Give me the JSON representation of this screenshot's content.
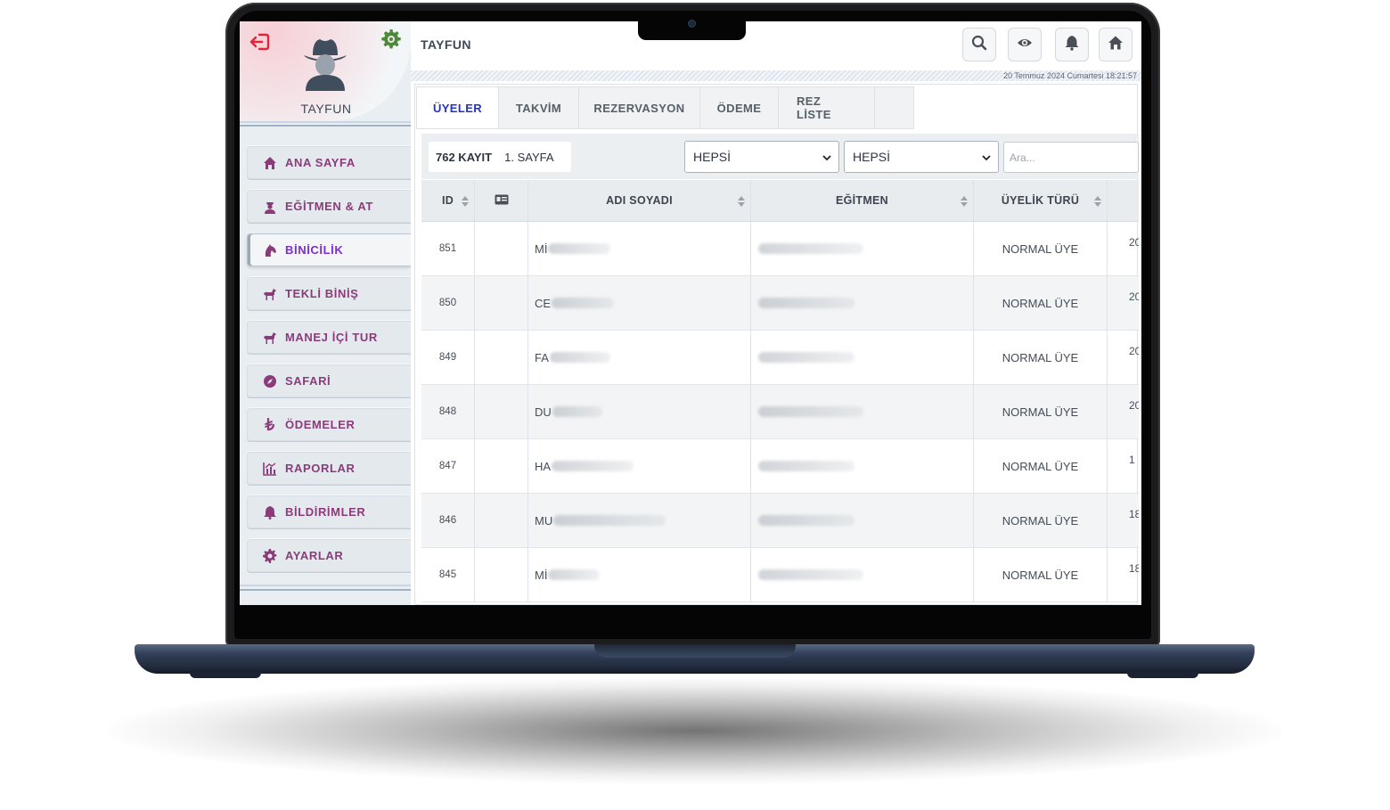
{
  "user": {
    "name": "TAYFUN"
  },
  "topbar": {
    "title": "TAYFUN",
    "datetime": "20 Temmuz 2024 Cumartesi 18:21:57"
  },
  "menu": [
    {
      "label": "ANA SAYFA",
      "icon": "home-icon",
      "active": false
    },
    {
      "label": "EĞİTMEN & AT",
      "icon": "instructor-icon",
      "active": false
    },
    {
      "label": "BİNİCİLİK",
      "icon": "horse-head-icon",
      "active": true
    },
    {
      "label": "TEKLİ BİNİŞ",
      "icon": "horse-icon",
      "active": false
    },
    {
      "label": "MANEJ İÇİ TUR",
      "icon": "horse-icon",
      "active": false
    },
    {
      "label": "SAFARİ",
      "icon": "compass-icon",
      "active": false
    },
    {
      "label": "ÖDEMELER",
      "icon": "lira-icon",
      "active": false
    },
    {
      "label": "RAPORLAR",
      "icon": "chart-icon",
      "active": false
    },
    {
      "label": "BİLDİRİMLER",
      "icon": "bell-icon",
      "active": false
    },
    {
      "label": "AYARLAR",
      "icon": "gear-icon",
      "active": false
    }
  ],
  "tabs": [
    {
      "label": "ÜYELER",
      "active": true
    },
    {
      "label": "TAKVİM",
      "active": false
    },
    {
      "label": "REZERVASYON",
      "active": false
    },
    {
      "label": "ÖDEME",
      "active": false
    },
    {
      "label": "REZ LİSTE",
      "active": false
    }
  ],
  "filters": {
    "count": "762 KAYIT",
    "page": "1. SAYFA",
    "select1": "HEPSİ",
    "select2": "HEPSİ",
    "search_placeholder": "Ara..."
  },
  "table": {
    "headers": {
      "id": "ID",
      "name": "ADI SOYADI",
      "instructor": "EĞİTMEN",
      "type": "ÜYELİK TÜRÜ"
    },
    "rows": [
      {
        "id": "851",
        "name": "Mİ",
        "instructor": "",
        "type": "NORMAL ÜYE",
        "date": "20"
      },
      {
        "id": "850",
        "name": "CE",
        "instructor": "",
        "type": "NORMAL ÜYE",
        "date": "20"
      },
      {
        "id": "849",
        "name": "FA",
        "instructor": "",
        "type": "NORMAL ÜYE",
        "date": "20"
      },
      {
        "id": "848",
        "name": "DU",
        "instructor": "",
        "type": "NORMAL ÜYE",
        "date": "20"
      },
      {
        "id": "847",
        "name": "HA",
        "instructor": "",
        "type": "NORMAL ÜYE",
        "date": "1"
      },
      {
        "id": "846",
        "name": "MU",
        "instructor": "",
        "type": "NORMAL ÜYE",
        "date": "18"
      },
      {
        "id": "845",
        "name": "Mİ",
        "instructor": "",
        "type": "NORMAL ÜYE",
        "date": "18"
      }
    ]
  },
  "colors": {
    "accent": "#8b3b7a",
    "active_menu": "#7b2fd0",
    "active_tab": "#2233cc",
    "logout": "#e0243a",
    "gear": "#4a8a3a"
  }
}
